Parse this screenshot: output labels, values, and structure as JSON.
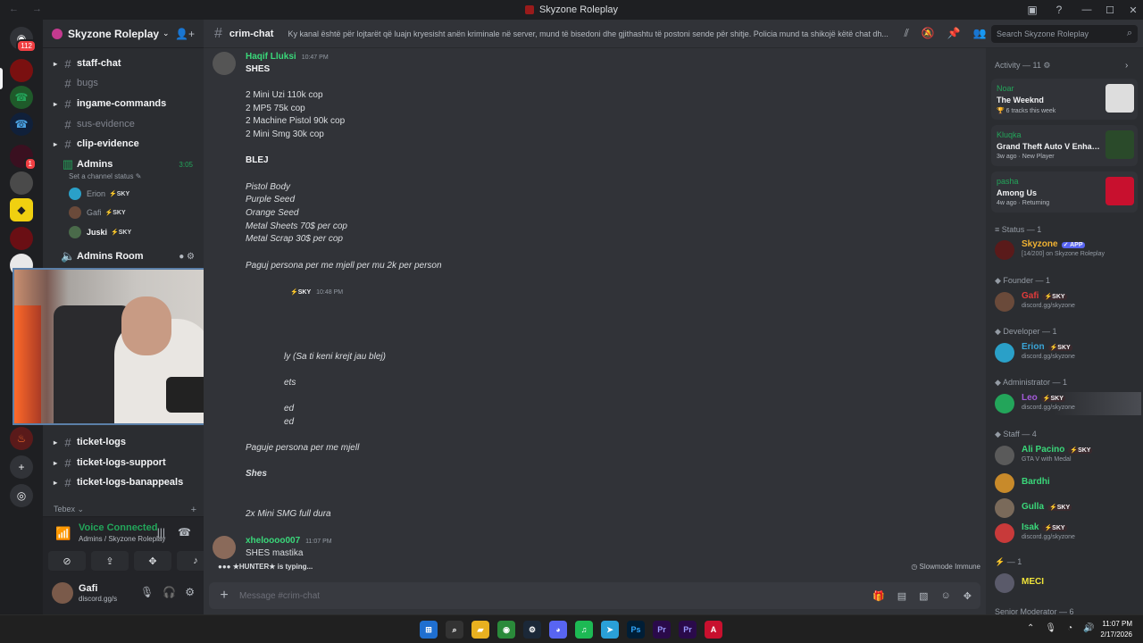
{
  "window": {
    "title": "Skyzone Roleplay"
  },
  "servers": {
    "home_badge": "112",
    "badge_1": "1",
    "badge_2": "1"
  },
  "sidebar": {
    "guild_name": "Skyzone Roleplay",
    "channels": [
      {
        "name": "staff-chat"
      },
      {
        "name": "bugs"
      },
      {
        "name": "ingame-commands"
      },
      {
        "name": "sus-evidence"
      },
      {
        "name": "clip-evidence"
      }
    ],
    "voice_channel": {
      "name": "Admins",
      "time": "3:05",
      "status_hint": "Set a channel status"
    },
    "voice_users": [
      {
        "name": "Erion",
        "tag": "⚡SKY"
      },
      {
        "name": "Gafi",
        "tag": "⚡SKY"
      },
      {
        "name": "Juski",
        "tag": "⚡SKY"
      }
    ],
    "admins_room": "Admins Room",
    "lower_channels": [
      {
        "name": "ticket-logs"
      },
      {
        "name": "ticket-logs-support"
      },
      {
        "name": "ticket-logs-banappeals"
      }
    ],
    "category": "Tebex"
  },
  "voice_panel": {
    "status": "Voice Connected",
    "location": "Admins / Skyzone Roleplay"
  },
  "user": {
    "name": "Gafi",
    "status": "discord.gg/s"
  },
  "chat": {
    "channel": "crim-chat",
    "topic": "Ky kanal është për lojtarët që luajn kryesisht anën kriminale në server, mund të bisedoni dhe gjithashtu të postoni sende për shitje. Policia mund ta shikojë këtë chat dh...",
    "search_placeholder": "Search Skyzone Roleplay",
    "msg1": {
      "author": "Haqif Lluksi",
      "time": "10:47 PM"
    },
    "lines1": [
      "SHES",
      "2 Mini Uzi 110k cop",
      "2 MP5 75k cop",
      "2 Machine Pistol 90k cop",
      "2 Mini Smg 30k cop",
      "BLEJ",
      "Pistol Body",
      "Purple Seed",
      "Orange Seed",
      "Metal Sheets 70$ per cop",
      "Metal Scrap 30$ per cop",
      "Paguj persona per me mjell per mu 2k per person"
    ],
    "msg2": {
      "tag": "⚡SKY",
      "time": "10:48 PM"
    },
    "lines2": [
      "ly (Sa ti keni krejt jau blej)",
      "ets",
      "ed",
      "ed",
      "Paguje persona per me mjell",
      "Shes",
      "2x Mini SMG full dura"
    ],
    "msg3": {
      "author": "xheloooo007",
      "time": "11:07 PM",
      "text": "SHES mastika"
    },
    "typing": "★HUNTER★ is typing...",
    "slowmode": "Slowmode Immune",
    "input_placeholder": "Message #crim-chat"
  },
  "members": {
    "activity_header": "Activity — 11",
    "activities": [
      {
        "user": "Noar",
        "title": "The Weeknd",
        "sub": "6 tracks this week"
      },
      {
        "user": "Kluqka",
        "title": "Grand Theft Auto V Enhan...",
        "sub": "3w ago · New Player"
      },
      {
        "user": "pasha",
        "title": "Among Us",
        "sub": "4w ago · Returning"
      }
    ],
    "groups": {
      "status": "Status — 1",
      "founder": "Founder — 1",
      "developer": "Developer — 1",
      "administrator": "Administrator — 1",
      "staff": "Staff — 4",
      "unnamed": "— 1",
      "senior": "Senior Moderator — 6"
    },
    "list": [
      {
        "name": "Skyzone",
        "tag": "✓ APP",
        "sub": "[14/200] on Skyzone Roleplay",
        "color": "#f0b232"
      },
      {
        "name": "Gafi",
        "tag": "⚡SKY",
        "sub": "discord.gg/skyzone",
        "color": "#e23b3b"
      },
      {
        "name": "Erion",
        "tag": "⚡SKY",
        "sub": "discord.gg/skyzone",
        "color": "#3aa5d8"
      },
      {
        "name": "Leo",
        "tag": "⚡SKY",
        "sub": "discord.gg/skyzone",
        "color": "#a35ad8"
      },
      {
        "name": "Ali Pacino",
        "tag": "⚡SKY",
        "sub": "GTA V with Medal",
        "color": "#3ad87a"
      },
      {
        "name": "Bardhi",
        "tag": "",
        "sub": "",
        "color": "#3ad87a"
      },
      {
        "name": "Gulla",
        "tag": "⚡SKY",
        "sub": "",
        "color": "#3ad87a"
      },
      {
        "name": "Isak",
        "tag": "⚡SKY",
        "sub": "discord.gg/skyzone",
        "color": "#3ad87a"
      },
      {
        "name": "MECI",
        "tag": "",
        "sub": "",
        "color": "#f0e43a"
      }
    ]
  },
  "taskbar": {
    "time": "11:07 PM",
    "date": "2/17/2026"
  }
}
